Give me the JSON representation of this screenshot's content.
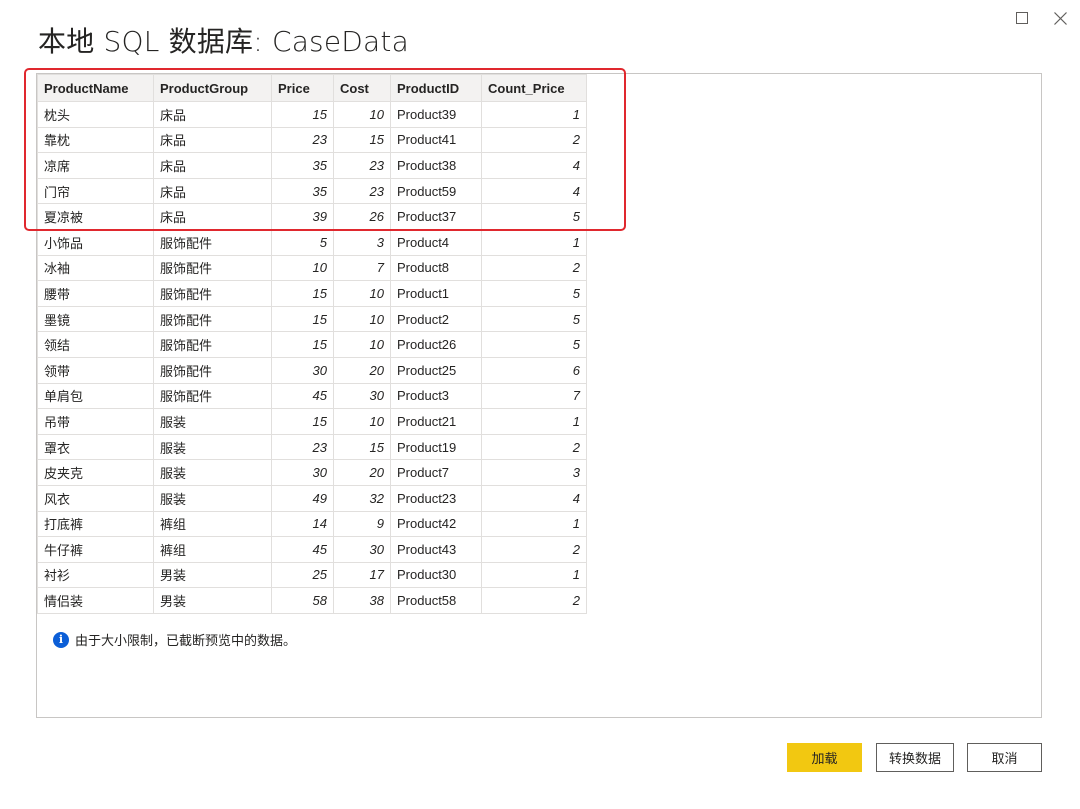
{
  "window": {
    "title": "本地 SQL 数据库: CaseData"
  },
  "table": {
    "columns": [
      "ProductName",
      "ProductGroup",
      "Price",
      "Cost",
      "ProductID",
      "Count_Price"
    ],
    "rows": [
      [
        "枕头",
        "床品",
        "15",
        "10",
        "Product39",
        "1"
      ],
      [
        "靠枕",
        "床品",
        "23",
        "15",
        "Product41",
        "2"
      ],
      [
        "凉席",
        "床品",
        "35",
        "23",
        "Product38",
        "4"
      ],
      [
        "门帘",
        "床品",
        "35",
        "23",
        "Product59",
        "4"
      ],
      [
        "夏凉被",
        "床品",
        "39",
        "26",
        "Product37",
        "5"
      ],
      [
        "小饰品",
        "服饰配件",
        "5",
        "3",
        "Product4",
        "1"
      ],
      [
        "冰袖",
        "服饰配件",
        "10",
        "7",
        "Product8",
        "2"
      ],
      [
        "腰带",
        "服饰配件",
        "15",
        "10",
        "Product1",
        "5"
      ],
      [
        "墨镜",
        "服饰配件",
        "15",
        "10",
        "Product2",
        "5"
      ],
      [
        "领结",
        "服饰配件",
        "15",
        "10",
        "Product26",
        "5"
      ],
      [
        "领带",
        "服饰配件",
        "30",
        "20",
        "Product25",
        "6"
      ],
      [
        "单肩包",
        "服饰配件",
        "45",
        "30",
        "Product3",
        "7"
      ],
      [
        "吊带",
        "服装",
        "15",
        "10",
        "Product21",
        "1"
      ],
      [
        "罩衣",
        "服装",
        "23",
        "15",
        "Product19",
        "2"
      ],
      [
        "皮夹克",
        "服装",
        "30",
        "20",
        "Product7",
        "3"
      ],
      [
        "风衣",
        "服装",
        "49",
        "32",
        "Product23",
        "4"
      ],
      [
        "打底裤",
        "裤组",
        "14",
        "9",
        "Product42",
        "1"
      ],
      [
        "牛仔裤",
        "裤组",
        "45",
        "30",
        "Product43",
        "2"
      ],
      [
        "衬衫",
        "男装",
        "25",
        "17",
        "Product30",
        "1"
      ],
      [
        "情侣装",
        "男装",
        "58",
        "38",
        "Product58",
        "2"
      ]
    ]
  },
  "notice": {
    "icon": "info-icon",
    "text": "由于大小限制，已截断预览中的数据。"
  },
  "buttons": {
    "load": "加载",
    "transform": "转换数据",
    "cancel": "取消"
  },
  "colors": {
    "accent": "#f2c811",
    "highlight": "#e0282e",
    "info": "#0b5ed7"
  }
}
